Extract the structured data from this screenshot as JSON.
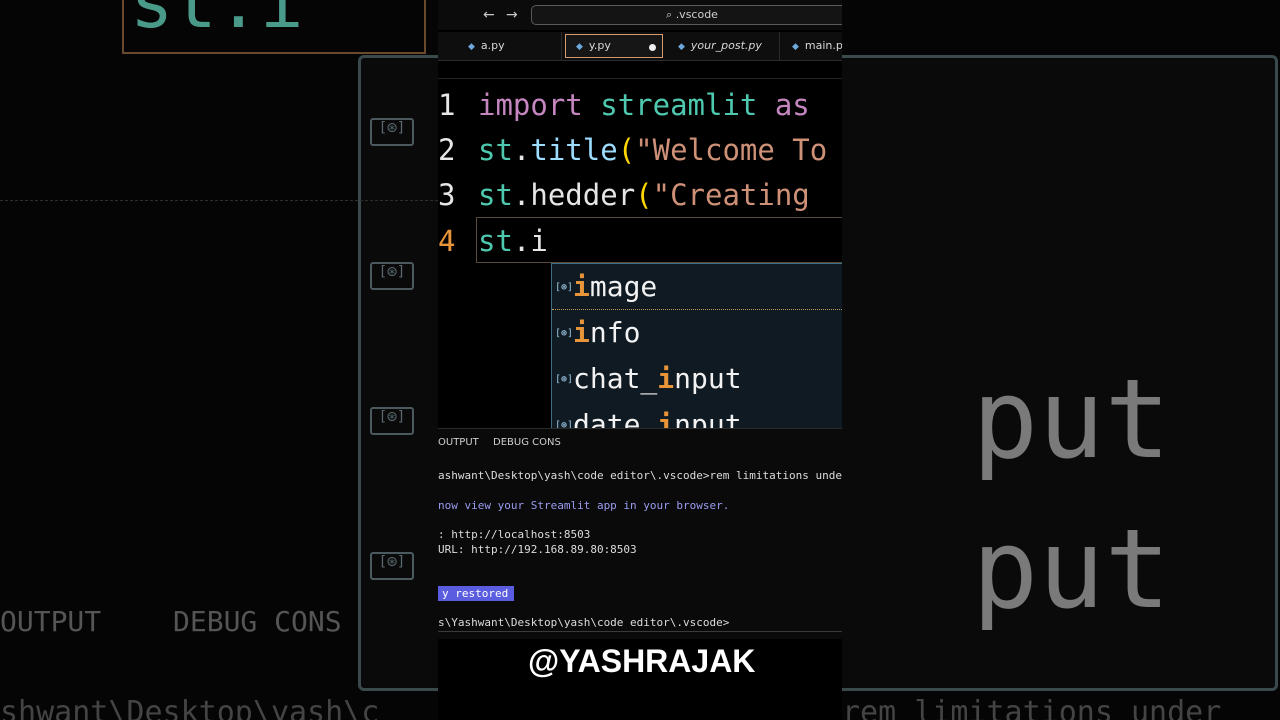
{
  "nav": {
    "back": "←",
    "forward": "→"
  },
  "search": {
    "text": "⌕ .vscode"
  },
  "tabs": [
    {
      "label": "a.py"
    },
    {
      "label": "y.py"
    },
    {
      "label": "your_post.py"
    },
    {
      "label": "main.py"
    }
  ],
  "code": [
    {
      "num": "1",
      "tokens": [
        "import",
        "streamlit",
        "as"
      ]
    },
    {
      "num": "2",
      "prefix": "st",
      "dot": ".",
      "func": "title",
      "open": "(",
      "string": "\"Welcome To"
    },
    {
      "num": "3",
      "prefix": "st",
      "dot": ".",
      "func": "hedder",
      "open": "(",
      "string": "\"Creating"
    },
    {
      "num": "4",
      "prefix": "st",
      "dot": ".",
      "typed": "i"
    }
  ],
  "suggestions": [
    {
      "before": "",
      "match": "i",
      "after": "mage"
    },
    {
      "before": "",
      "match": "i",
      "after": "nfo"
    },
    {
      "before": "chat_",
      "match": "i",
      "after": "nput"
    },
    {
      "before": "date_",
      "match": "i",
      "after": "nput"
    }
  ],
  "panel_tabs": {
    "output": "OUTPUT",
    "debug": "DEBUG CONS"
  },
  "terminal": {
    "cmd": "ashwant\\Desktop\\yash\\code editor\\.vscode>rem limitations under",
    "info": "now view your Streamlit app in your browser.",
    "local": ": http://localhost:8503",
    "network": "URL: http://192.168.89.80:8503",
    "badge": "y restored",
    "prompt": "s\\Yashwant\\Desktop\\yash\\code editor\\.vscode>"
  },
  "watermark": "@YASHRAJAK",
  "background": {
    "top_text": "st.i",
    "right_big": [
      "put",
      "put"
    ],
    "output_label": "OUTPUT",
    "debug_label": "DEBUG CONS",
    "bottom_left": "shwant\\Desktop\\yash\\c",
    "bottom_right": "rem limitations under"
  }
}
